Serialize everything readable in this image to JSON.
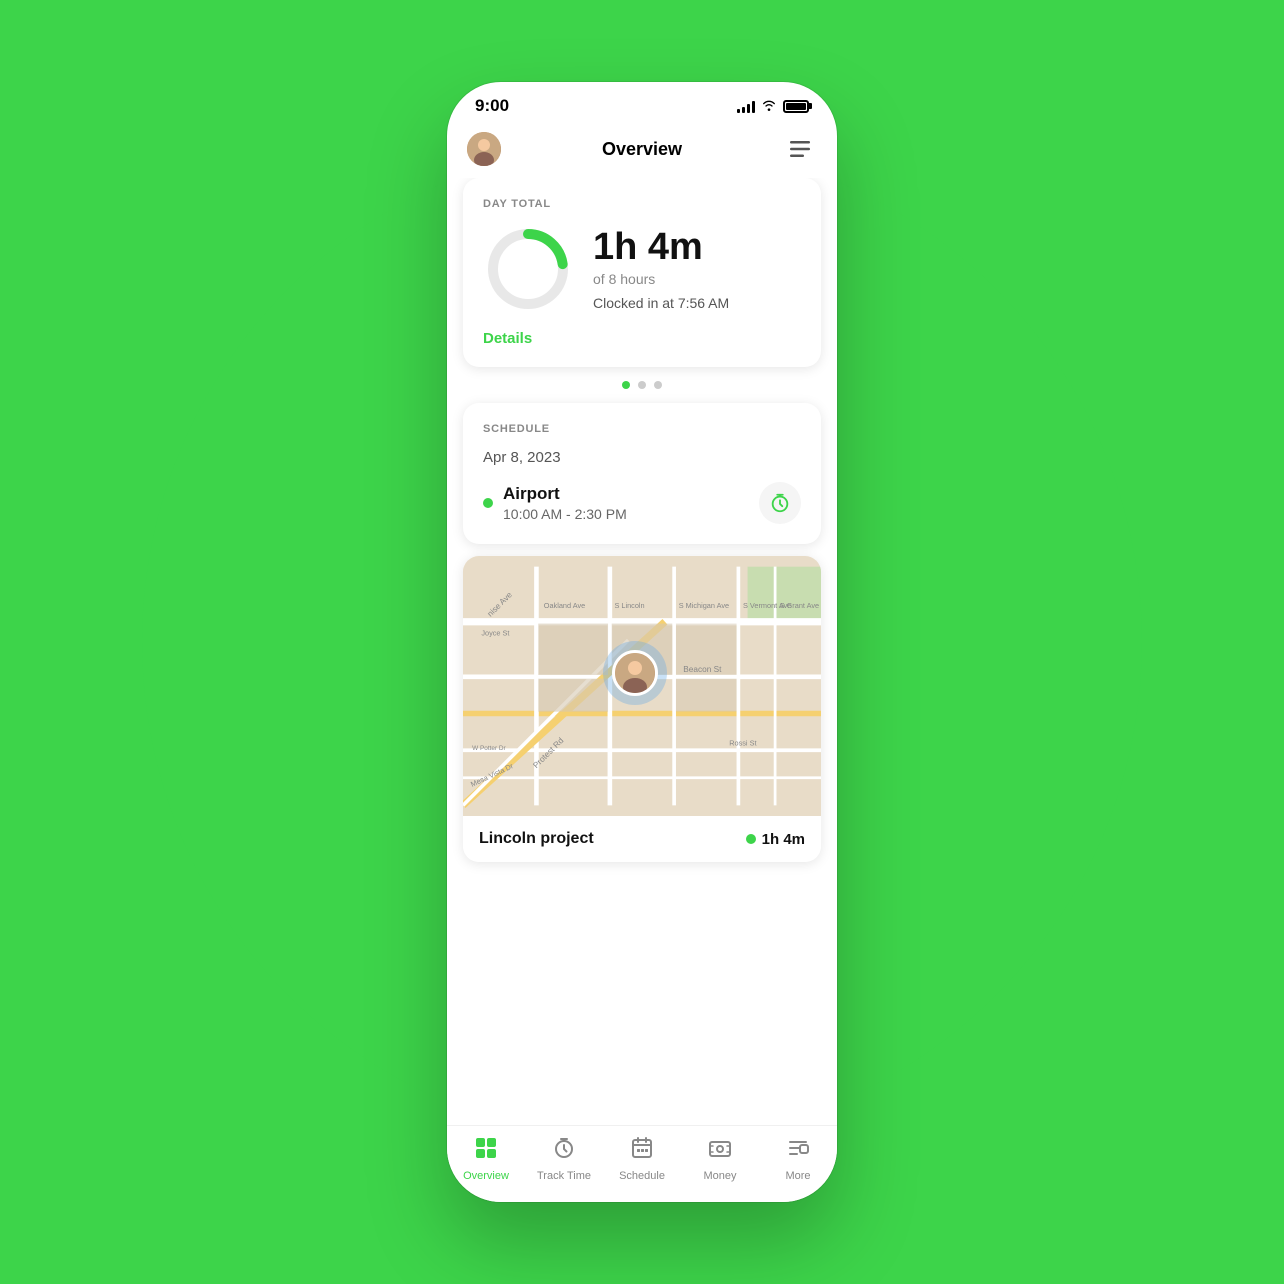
{
  "statusBar": {
    "time": "9:00",
    "signalBars": [
      4,
      6,
      8,
      10,
      12
    ],
    "batteryPercent": 85
  },
  "header": {
    "title": "Overview",
    "avatarAlt": "User avatar",
    "menuIcon": "menu"
  },
  "dayTotal": {
    "label": "DAY TOTAL",
    "hours": "1h 4m",
    "goal": "of 8 hours",
    "clockedIn": "Clocked in at 7:56 AM",
    "detailsLink": "Details",
    "progressPercent": 13
  },
  "pagination": {
    "total": 3,
    "active": 0
  },
  "schedule": {
    "label": "SCHEDULE",
    "date": "Apr 8, 2023",
    "jobName": "Airport",
    "jobTime": "10:00 AM - 2:30 PM"
  },
  "map": {
    "projectName": "Lincoln project",
    "trackedTime": "1h 4m"
  },
  "bottomNav": {
    "items": [
      {
        "id": "overview",
        "label": "Overview",
        "active": true
      },
      {
        "id": "track-time",
        "label": "Track Time",
        "active": false
      },
      {
        "id": "schedule",
        "label": "Schedule",
        "active": false
      },
      {
        "id": "money",
        "label": "Money",
        "active": false
      },
      {
        "id": "more",
        "label": "More",
        "active": false
      }
    ]
  }
}
